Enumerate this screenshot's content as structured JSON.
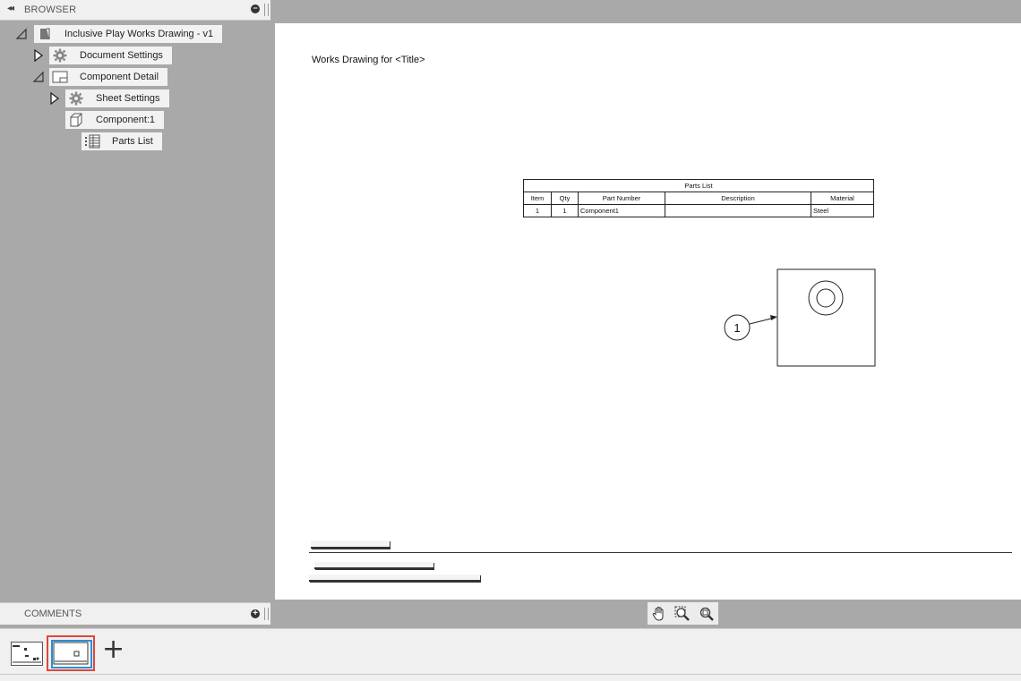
{
  "browser": {
    "title": "BROWSER",
    "collapse_glyph": "◂◂",
    "tree": [
      {
        "label": "Inclusive Play Works Drawing - v1",
        "icon": "drawing-document-icon",
        "toggle": "expanded"
      },
      {
        "label": "Document Settings",
        "icon": "gear-icon",
        "toggle": "collapsed"
      },
      {
        "label": "Component Detail",
        "icon": "sheet-icon",
        "toggle": "expanded"
      },
      {
        "label": "Sheet Settings",
        "icon": "gear-icon",
        "toggle": "collapsed"
      },
      {
        "label": "Component:1",
        "icon": "component-view-icon",
        "toggle": "none"
      },
      {
        "label": "Parts List",
        "icon": "parts-list-icon",
        "toggle": "none"
      }
    ]
  },
  "sheet": {
    "drawing_title": "Works Drawing for <Title>",
    "parts_list": {
      "title": "Parts List",
      "columns": [
        "Item",
        "Qty",
        "Part Number",
        "Description",
        "Material"
      ],
      "rows": [
        [
          "1",
          "1",
          "Component1",
          "",
          "Steel"
        ]
      ]
    },
    "balloon_number": "1"
  },
  "comments": {
    "title": "COMMENTS"
  },
  "nav_toolbar": {
    "tools": [
      "pan-icon",
      "zoom-window-icon",
      "zoom-fit-icon"
    ]
  },
  "sheet_strip": {
    "add_glyph": "+",
    "sheets": [
      "sheet-1-thumbnail",
      "sheet-2-thumbnail"
    ],
    "active_sheet": 2,
    "highlight_color": "#e0463c",
    "selection_color": "#2a8fd6"
  }
}
